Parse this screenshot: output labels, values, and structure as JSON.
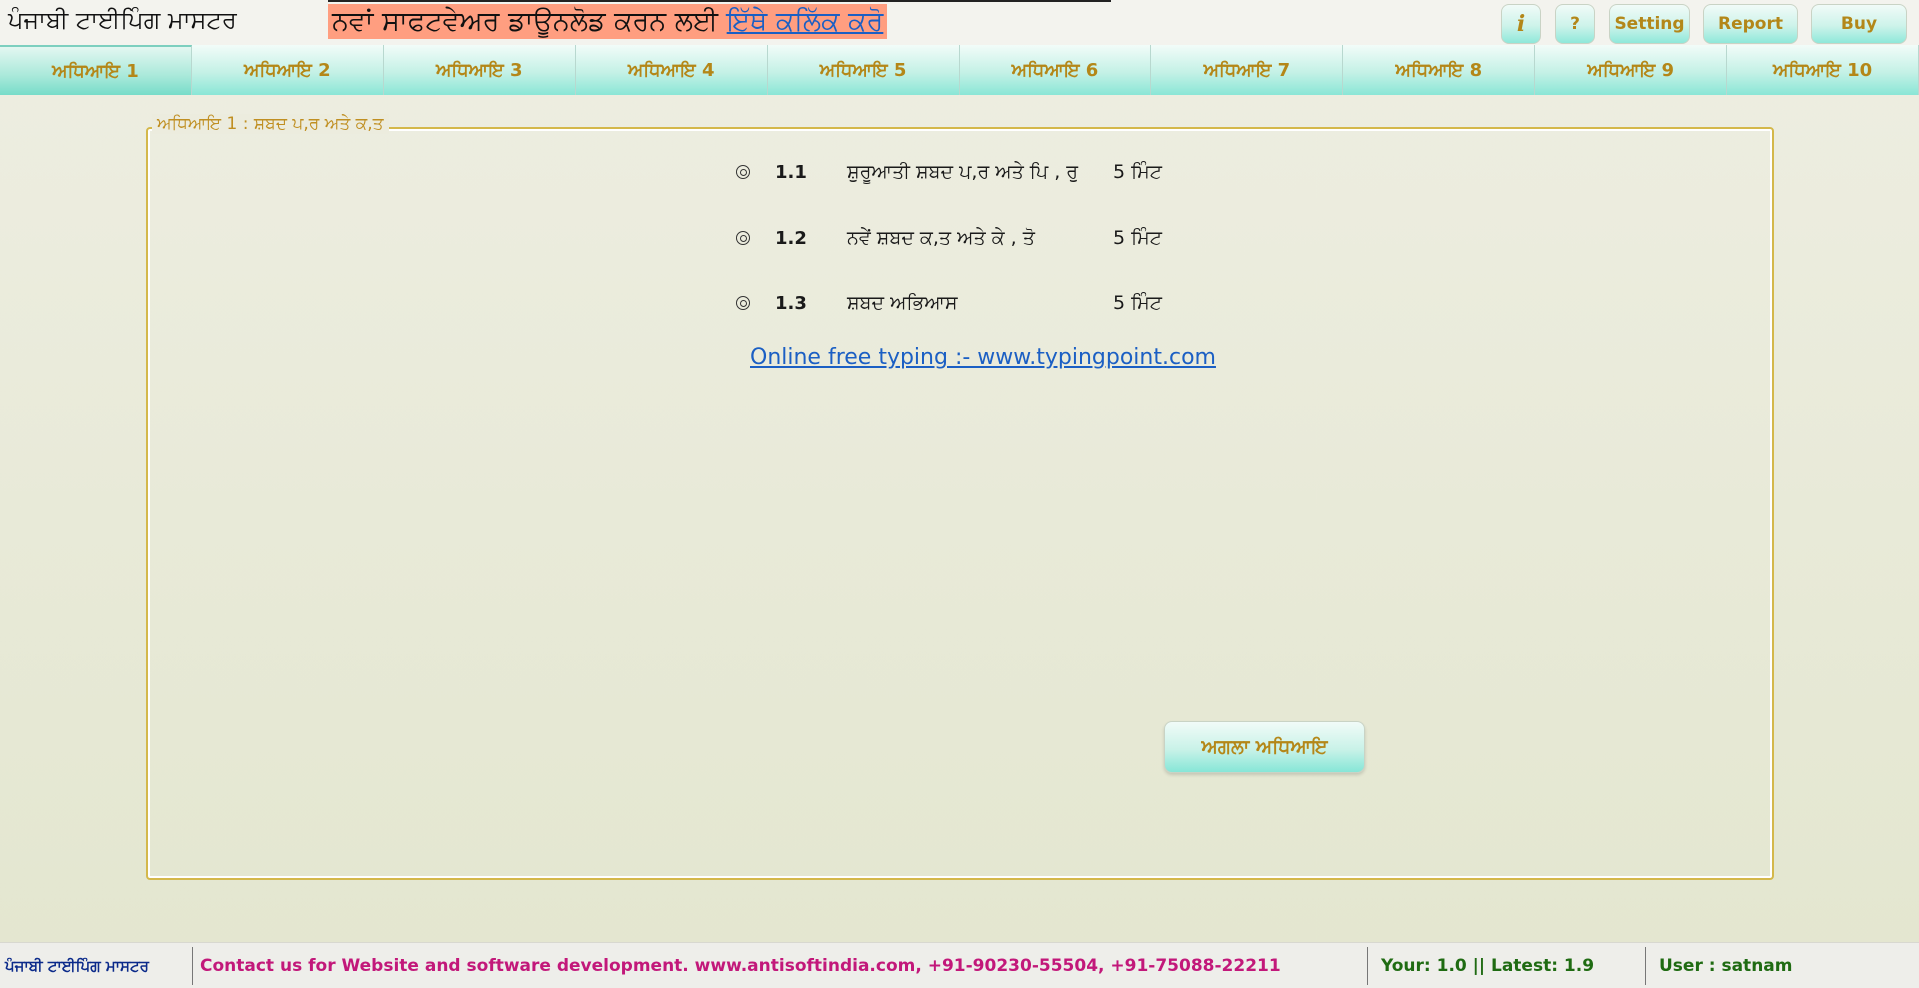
{
  "header": {
    "app_title": "ਪੰਜਾਬੀ ਟਾਈਪਿੰਗ ਮਾਸਟਰ",
    "banner_text": "ਨਵਾਂ ਸਾਫਟਵੇਅਰ ਡਾਊਨਲੋਡ ਕਰਨ ਲਈ ",
    "banner_link": "ਇੱਥੇ ਕਲਿੱਕ ਕਰੋ",
    "buttons": {
      "info": "i",
      "help": "?",
      "setting": "Setting",
      "report": "Report",
      "buy": "Buy"
    }
  },
  "tabs": [
    {
      "label": "ਅਧਿਆਇ 1",
      "active": true
    },
    {
      "label": "ਅਧਿਆਇ 2"
    },
    {
      "label": "ਅਧਿਆਇ 3"
    },
    {
      "label": "ਅਧਿਆਇ 4"
    },
    {
      "label": "ਅਧਿਆਇ 5"
    },
    {
      "label": "ਅਧਿਆਇ 6"
    },
    {
      "label": "ਅਧਿਆਇ 7"
    },
    {
      "label": "ਅਧਿਆਇ 8"
    },
    {
      "label": "ਅਧਿਆਇ 9"
    },
    {
      "label": "ਅਧਿਆਇ 10"
    }
  ],
  "chapter": {
    "title": "ਅਧਿਆਇ 1 : ਸ਼ਬਦ ਪ,ਰ ਅਤੇ ਕ,ਤ",
    "lessons": [
      {
        "num": "1.1",
        "name": "ਸ਼ੁਰੂਆਤੀ ਸ਼ਬਦ ਪ,ਰ ਅਤੇ  ਪਿ , ਰੁ",
        "time": "5 ਮਿੰਟ"
      },
      {
        "num": "1.2",
        "name": "ਨਵੇਂ ਸ਼ਬਦ ਕ,ਤ ਅਤੇ ਕੇ , ਤੋ",
        "time": "5 ਮਿੰਟ"
      },
      {
        "num": "1.3",
        "name": "ਸ਼ਬਦ ਅਭਿਆਸ",
        "time": "5 ਮਿੰਟ"
      }
    ],
    "online_link": "Online free typing :- www.typingpoint.com",
    "next_button": "ਅਗਲਾ ਅਧਿਆਇ"
  },
  "statusbar": {
    "app_name": "ਪੰਜਾਬੀ ਟਾਈਪਿੰਗ ਮਾਸਟਰ",
    "contact": "Contact us for Website and software development. www.antisoftindia.com, +91-90230-55504, +91-75088-22211",
    "version": "Your: 1.0 || Latest: 1.9",
    "user": "User : satnam"
  },
  "colors": {
    "tab_text": "#b48718",
    "banner_bg": "#ff9e80",
    "link": "#1b5fc4",
    "contact_text": "#c2187a",
    "version_text": "#1f6b12",
    "app_name_text": "#0b2a8a"
  }
}
